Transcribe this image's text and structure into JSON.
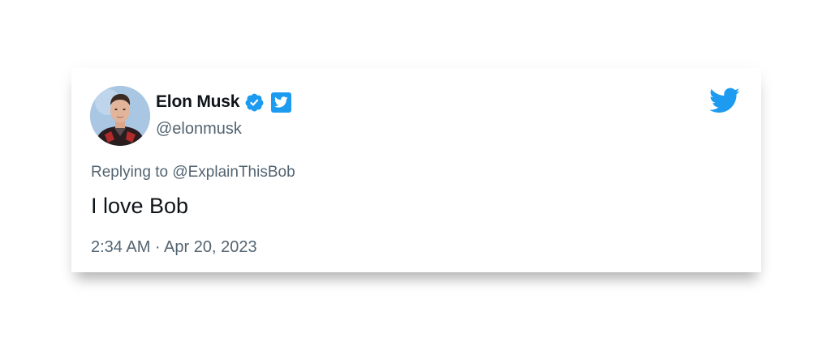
{
  "tweet": {
    "author": {
      "display_name": "Elon Musk",
      "handle": "@elonmusk",
      "verified": true,
      "avatar_icon": "profile-photo"
    },
    "reply": {
      "prefix": "Replying to",
      "to_handle": "@ExplainThisBob"
    },
    "text": "I love Bob",
    "timestamp": "2:34 AM · Apr 20, 2023"
  },
  "icons": {
    "verified": "verified-badge-icon",
    "twitter_square": "twitter-square-icon",
    "brand": "twitter-bird-icon"
  },
  "colors": {
    "brand_blue": "#1d9bf0",
    "text_primary": "#0f1419",
    "text_secondary": "#536471"
  }
}
